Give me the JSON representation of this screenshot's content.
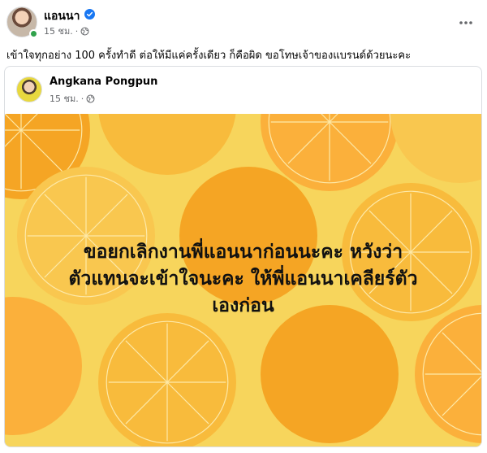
{
  "post": {
    "author_name": "แอนนา",
    "time": "15 ชม.",
    "dot": "·",
    "text": "เข้าใจทุกอย่าง 100 ครั้งทำดี ต่อให้มีแค่ครั้งเดียว ก็คือผิด ขอโทษเจ้าของแบรนด์ด้วยนะคะ"
  },
  "shared": {
    "author_name": "Angkana Pongpun",
    "time": "15 ชม.",
    "dot": "·",
    "image_text_lines": [
      "ขอยกเลิกงานพี่แอนนาก่อนนะคะ หวังว่า",
      "ตัวแทนจะเข้าใจนะคะ ให้พี่แอนนาเคลียร์ตัว",
      "เองก่อน"
    ]
  },
  "colors": {
    "verified": "#1877f2",
    "online": "#31a24c",
    "background_yellow": "#f7d55c",
    "orange": "#f5a524",
    "light_orange": "#f8bb3c"
  },
  "icons": [
    "verified-badge-icon",
    "globe-icon",
    "more-options-icon"
  ]
}
